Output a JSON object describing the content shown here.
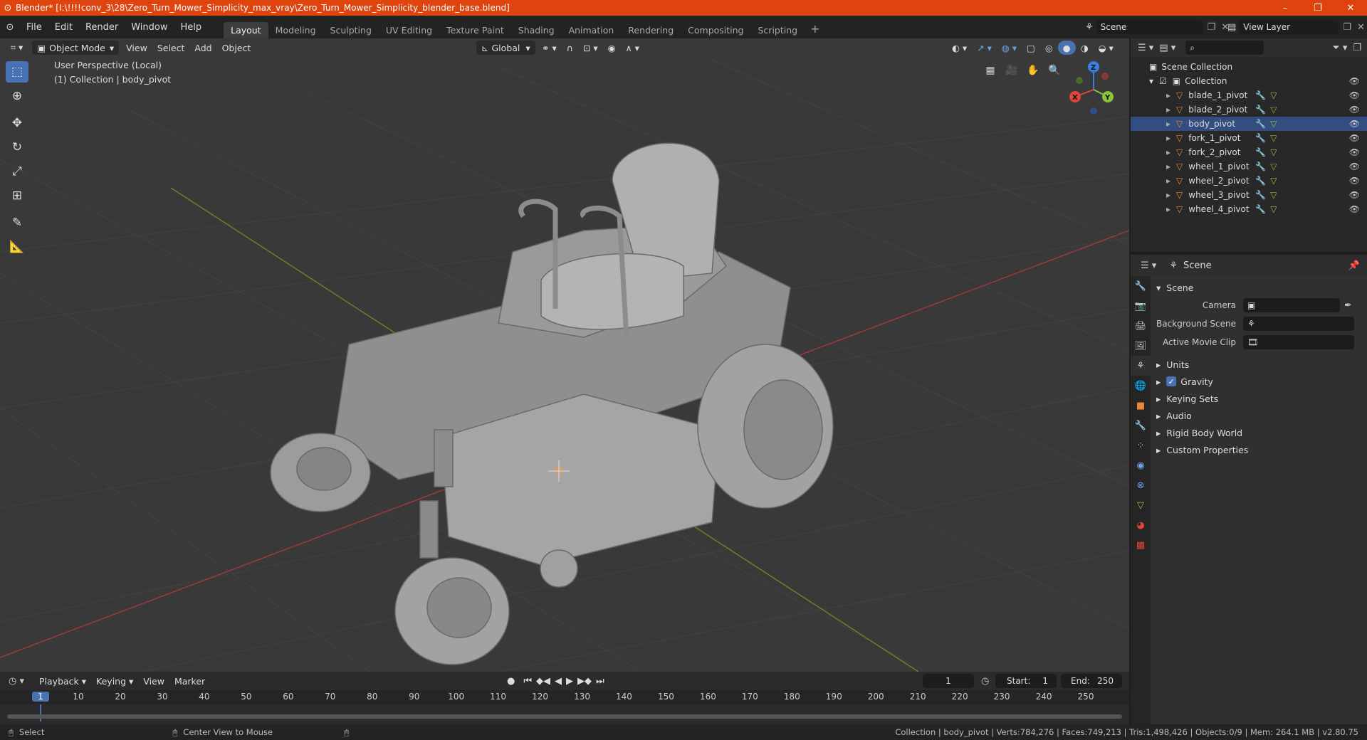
{
  "window": {
    "title": "Blender* [I:\\!!!!conv_3\\28\\Zero_Turn_Mower_Simplicity_max_vray\\Zero_Turn_Mower_Simplicity_blender_base.blend]",
    "minimize": "–",
    "maximize": "❐",
    "close": "✕"
  },
  "menubar": {
    "items": [
      "File",
      "Edit",
      "Render",
      "Window",
      "Help"
    ],
    "workspaces": [
      "Layout",
      "Modeling",
      "Sculpting",
      "UV Editing",
      "Texture Paint",
      "Shading",
      "Animation",
      "Rendering",
      "Compositing",
      "Scripting"
    ],
    "active_workspace": "Layout",
    "scene": "Scene",
    "view_layer": "View Layer"
  },
  "viewport": {
    "mode": "Object Mode",
    "menus": [
      "View",
      "Select",
      "Add",
      "Object"
    ],
    "transform_orientation": "Global",
    "info_line1": "User Perspective (Local)",
    "info_line2": "(1) Collection | body_pivot",
    "gizmo": {
      "x": "X",
      "y": "Y",
      "z": "Z"
    }
  },
  "outliner": {
    "root": "Scene Collection",
    "collection": "Collection",
    "items": [
      "blade_1_pivot",
      "blade_2_pivot",
      "body_pivot",
      "fork_1_pivot",
      "fork_2_pivot",
      "wheel_1_pivot",
      "wheel_2_pivot",
      "wheel_3_pivot",
      "wheel_4_pivot"
    ],
    "selected": "body_pivot"
  },
  "properties": {
    "context": "Scene",
    "panel_title": "Scene",
    "fields": [
      {
        "label": "Camera",
        "value": ""
      },
      {
        "label": "Background Scene",
        "value": ""
      },
      {
        "label": "Active Movie Clip",
        "value": ""
      }
    ],
    "sections": [
      "Units",
      "Gravity",
      "Keying Sets",
      "Audio",
      "Rigid Body World",
      "Custom Properties"
    ],
    "gravity_checked": true
  },
  "timeline": {
    "menus": [
      "Playback",
      "Keying",
      "View",
      "Marker"
    ],
    "current_frame": "1",
    "start_label": "Start:",
    "start": "1",
    "end_label": "End:",
    "end": "250",
    "ticks": [
      "1",
      "10",
      "20",
      "30",
      "40",
      "50",
      "60",
      "70",
      "80",
      "90",
      "100",
      "110",
      "120",
      "130",
      "140",
      "150",
      "160",
      "170",
      "180",
      "190",
      "200",
      "210",
      "220",
      "230",
      "240",
      "250"
    ]
  },
  "statusbar": {
    "left": "Select",
    "middle": "Center View to Mouse",
    "right": "Collection | body_pivot | Verts:784,276 | Faces:749,213 | Tris:1,498,426 | Objects:0/9 | Mem: 264.1 MB | v2.80.75"
  },
  "colors": {
    "accent": "#4772b3",
    "titlebar": "#e0440e",
    "x_axis": "#e0443a",
    "y_axis": "#8bc43a",
    "z_axis": "#3a7fe0"
  }
}
